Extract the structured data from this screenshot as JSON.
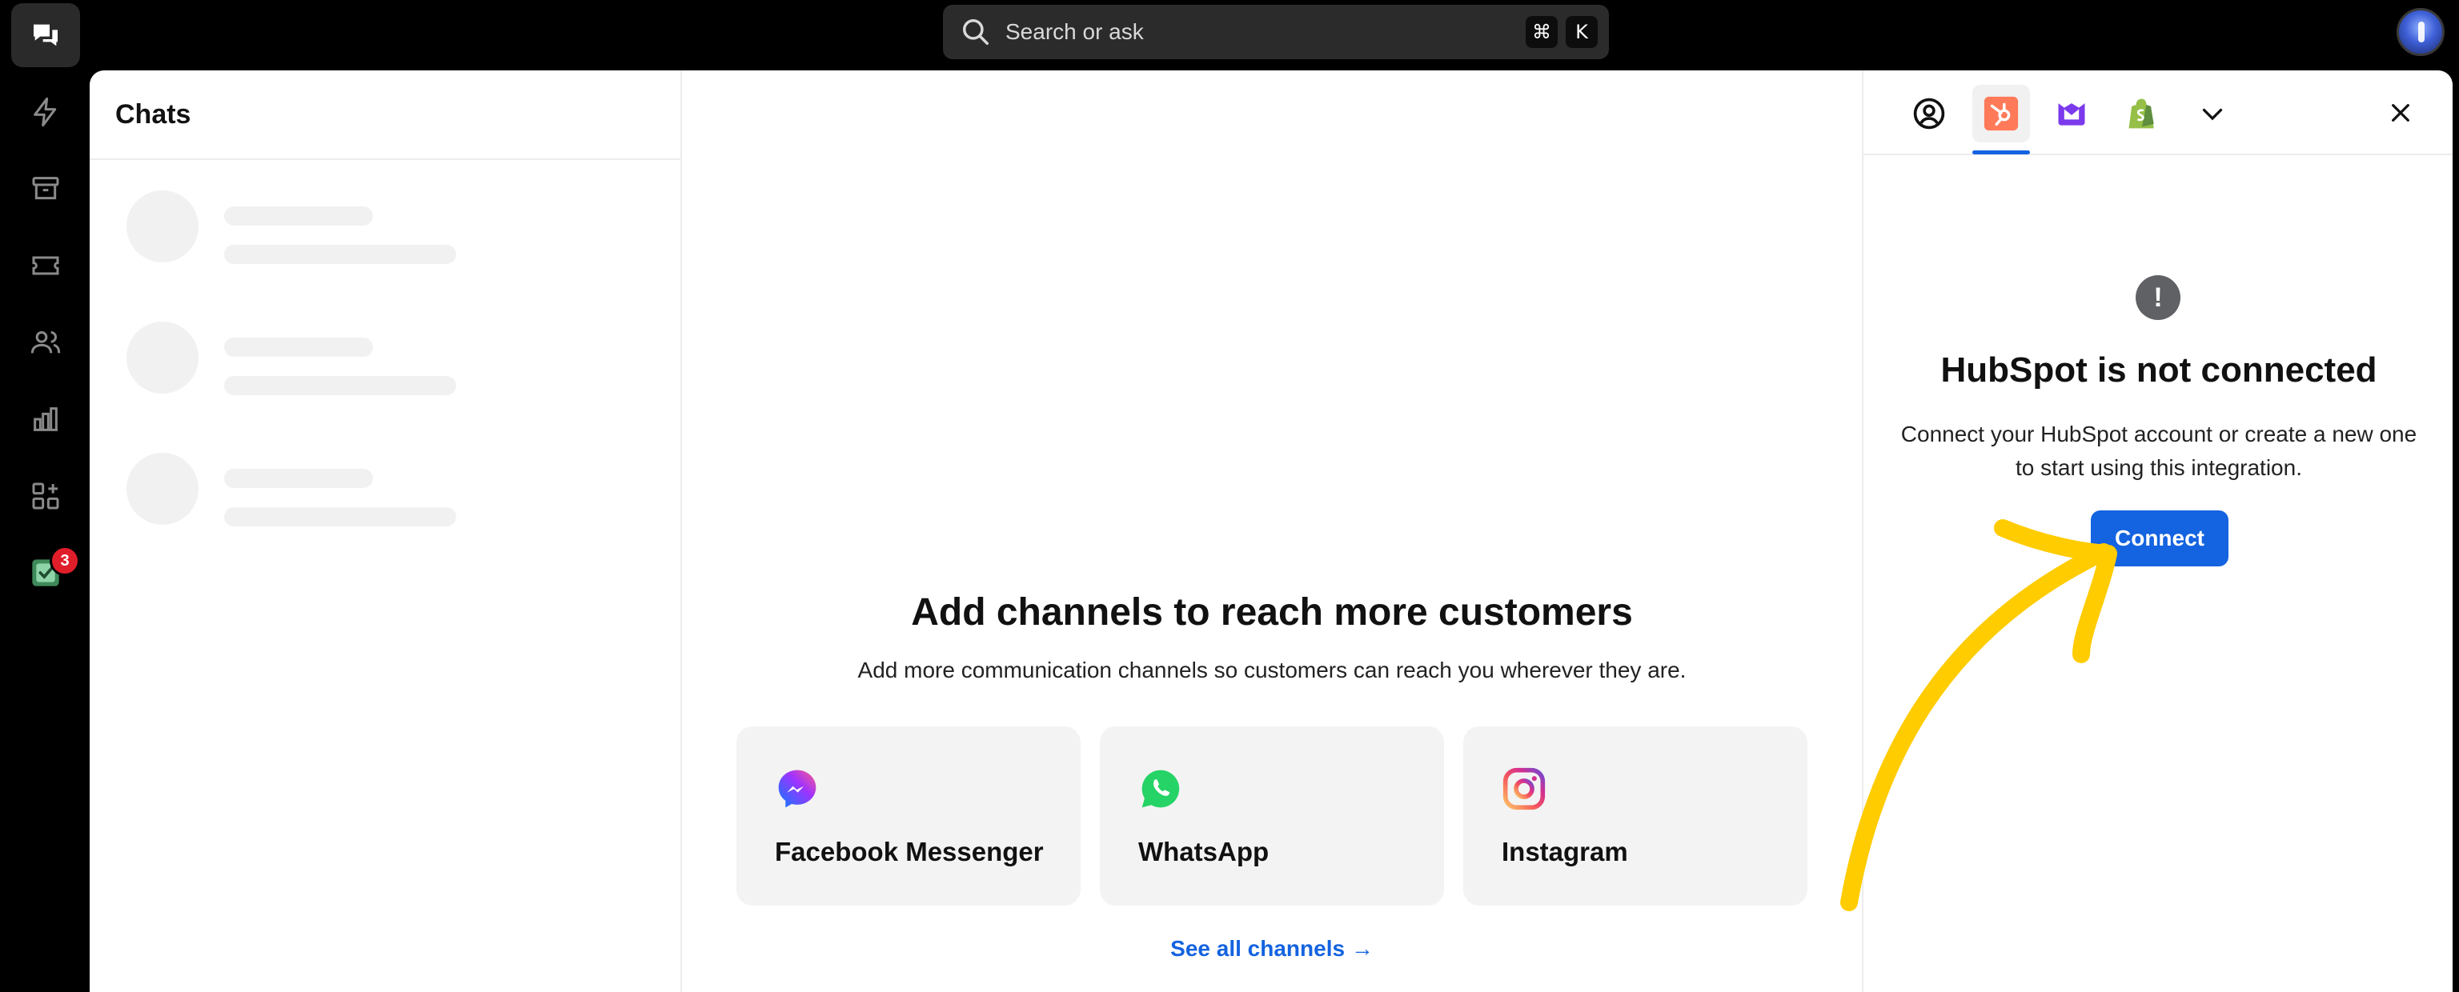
{
  "topbar": {
    "search_placeholder": "Search or ask",
    "shortcut_cmd": "⌘",
    "shortcut_key": "K"
  },
  "rail": {
    "tasks_badge": "3"
  },
  "chats": {
    "title": "Chats"
  },
  "center": {
    "title": "Add channels to reach more customers",
    "subtitle": "Add more communication channels so customers can reach you wherever they are.",
    "channels": [
      {
        "name": "Facebook Messenger",
        "icon": "messenger-icon"
      },
      {
        "name": "WhatsApp",
        "icon": "whatsapp-icon"
      },
      {
        "name": "Instagram",
        "icon": "instagram-icon"
      }
    ],
    "see_all": "See all channels →"
  },
  "integration": {
    "title": "HubSpot is not connected",
    "description": "Connect your HubSpot account or create a new one to start using this integration.",
    "connect_label": "Connect",
    "warning_glyph": "!"
  },
  "colors": {
    "accent": "#1463e0",
    "annotation_arrow": "#ffcc00",
    "hubspot": "#ff7a59",
    "shopify": "#5e8e3e"
  }
}
